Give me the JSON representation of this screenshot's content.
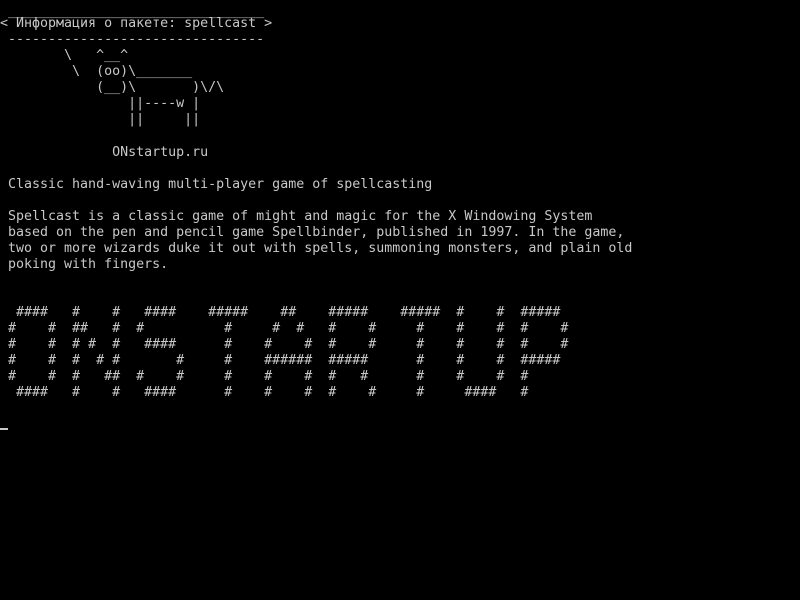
{
  "terminal": {
    "colors": {
      "background": "#000000",
      "foreground": "#c8c8c8"
    },
    "cowsay": {
      "border_top": " ________________________________",
      "title": "< Информация о пакете: spellcast >",
      "border_bottom": " --------------------------------",
      "cow": [
        "        \\   ^__^",
        "         \\  (oo)\\_______",
        "            (__)\\       )\\/\\",
        "                ||----w |",
        "                ||     ||"
      ],
      "site": "              ONstartup.ru"
    },
    "summary": " Classic hand-waving multi-player game of spellcasting",
    "description": [
      " Spellcast is a classic game of might and magic for the X Windowing System",
      " based on the pen and pencil game Spellbinder, published in 1997. In the game,",
      " two or more wizards duke it out with spells, summoning monsters, and plain old",
      " poking with fingers."
    ],
    "banner": [
      "  ####   #    #   ####    #####    ##    #####    #####  #    #  #####",
      " #    #  ##   #  #          #     #  #   #    #     #    #    #  #    #",
      " #    #  # #  #   ####      #    #    #  #    #     #    #    #  #    #",
      " #    #  #  # #       #     #    ######  #####      #    #    #  #####",
      " #    #  #   ##  #    #     #    #    #  #   #      #    #    #  #",
      "  ####   #    #   ####      #    #    #  #    #     #     ####   #"
    ]
  }
}
